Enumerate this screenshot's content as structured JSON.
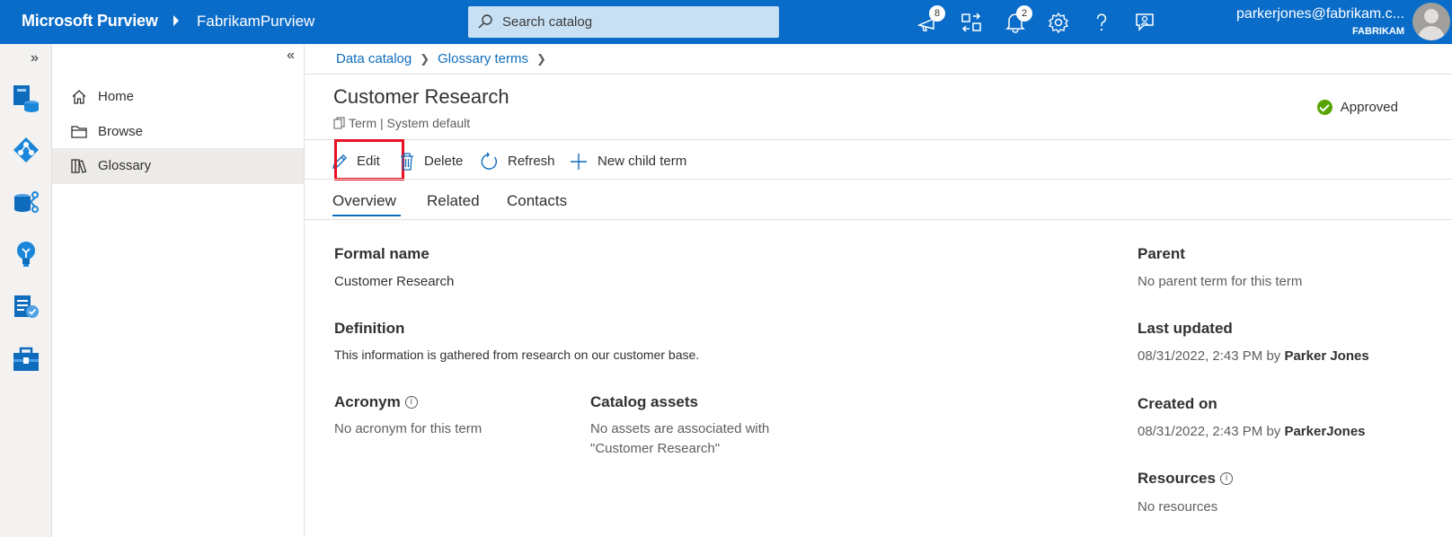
{
  "topbar": {
    "brand": "Microsoft Purview",
    "account": "FabrikamPurview",
    "search_placeholder": "Search catalog",
    "notifications_badge": "8",
    "alerts_badge": "2",
    "user_email": "parkerjones@fabrikam.c...",
    "user_org": "FABRIKAM"
  },
  "sidenav": {
    "items": [
      {
        "label": "Home",
        "icon": "home-icon"
      },
      {
        "label": "Browse",
        "icon": "folder-icon"
      },
      {
        "label": "Glossary",
        "icon": "book-icon"
      }
    ]
  },
  "breadcrumb": {
    "items": [
      "Data catalog",
      "Glossary terms"
    ]
  },
  "term": {
    "title": "Customer Research",
    "type": "Term",
    "template": "System default",
    "status": "Approved"
  },
  "commands": {
    "edit": "Edit",
    "delete": "Delete",
    "refresh": "Refresh",
    "new_child": "New child term"
  },
  "tabs": [
    "Overview",
    "Related",
    "Contacts"
  ],
  "overview": {
    "formal_name_label": "Formal name",
    "formal_name": "Customer Research",
    "definition_label": "Definition",
    "definition": "This information is gathered from research on our customer base.",
    "acronym_label": "Acronym",
    "acronym": "No acronym for this term",
    "assets_label": "Catalog assets",
    "assets_line1": "No assets are associated with",
    "assets_line2": "\"Customer Research\"",
    "parent_label": "Parent",
    "parent": "No parent term for this term",
    "last_updated_label": "Last updated",
    "last_updated": "08/31/2022, 2:43 PM by ",
    "last_updated_by": "Parker Jones",
    "created_label": "Created on",
    "created": "08/31/2022, 2:43 PM by ",
    "created_by": "ParkerJones",
    "resources_label": "Resources",
    "resources": "No resources"
  },
  "colors": {
    "topbar": "#0a6cc9",
    "accent": "#0f6cbd",
    "highlight": "#e81123",
    "approved": "#57a300"
  }
}
